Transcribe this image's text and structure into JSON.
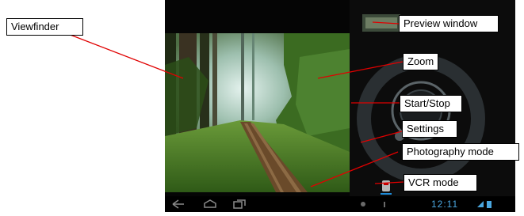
{
  "callouts": {
    "viewfinder": "Viewfinder",
    "preview_window": "Preview window",
    "zoom": "Zoom",
    "start_stop": "Start/Stop",
    "settings": "Settings",
    "photography_mode": "Photography mode",
    "vcr_mode": "VCR mode"
  },
  "status_bar": {
    "clock": "12:11"
  },
  "colors": {
    "leader_line": "#e00000",
    "callout_border": "#000000",
    "forest_green": "#3f6a25"
  },
  "icons": [
    "back-icon",
    "home-icon",
    "recent-apps-icon",
    "camera-mode-icon",
    "wifi-icon",
    "battery-icon"
  ]
}
